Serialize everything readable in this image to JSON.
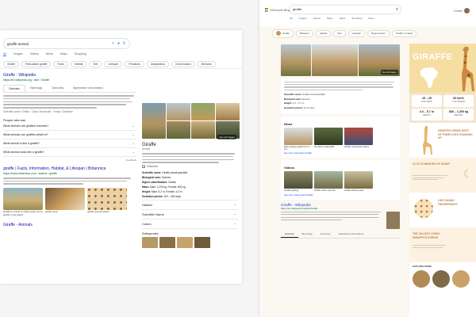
{
  "colors": {
    "google_link": "#1a0dab",
    "google_blue": "#1a73e8",
    "bing_blue": "#174ae4",
    "bing_accent": "#b7804a"
  },
  "google": {
    "query": "giraffe animal",
    "tabs": [
      "All",
      "Images",
      "Videos",
      "News",
      "Maps",
      "Shopping"
    ],
    "chips": [
      "Giraffe",
      "Reticulated giraffe",
      "Facts",
      "Habitat",
      "Diet",
      "Lifespan",
      "Predators",
      "Adaptations",
      "Conservation",
      "Behavior"
    ],
    "result1": {
      "title": "Giraffe - Wikipedia",
      "url": "https://en.wikipedia.org › wiki › Giraffe",
      "tabs": [
        "Overview",
        "Etymology",
        "Taxonomy",
        "Appearance and anatomy"
      ],
      "meta": "Scientific name: Giraffa · Class: Mammalia · Family: Giraffidae"
    },
    "paa": {
      "title": "People also ask",
      "items": [
        "What animals are giraffes enemies?",
        "What animals are giraffes afraid of?",
        "What animal is like a giraffe?",
        "What animal looks like a giraffe?"
      ],
      "feedback": "Feedback"
    },
    "result2": {
      "title": "giraffe | Facts, Information, Habitat, & Lifespan | Britannica",
      "url": "https://www.britannica.com › animal › giraffe",
      "thumbs": [
        "Giraffe in a field of yellow grass and a giraffe in the plains",
        "giraffe neck",
        "giraffe animal pattern"
      ]
    },
    "result3": {
      "title": "Giraffe - Animals"
    },
    "kp": {
      "more_images": "See all images",
      "title": "Giraffe",
      "subtitle": "Animal",
      "source": "Wikipedia",
      "facts": [
        {
          "k": "Scientific name:",
          "v": "Giraffa camelopardalis"
        },
        {
          "k": "Biological rank:",
          "v": "Species"
        },
        {
          "k": "Higher classification:",
          "v": "Giraffa"
        },
        {
          "k": "Mass:",
          "v": "Male: 1,200 kg, Female: 830 kg"
        },
        {
          "k": "Height:",
          "v": "Male: 5.2 m, Female: 4.3 m"
        },
        {
          "k": "Gestation period:",
          "v": "400 – 460 days"
        }
      ],
      "sections": [
        "Habitat",
        "Scientific Name",
        "Colors",
        "Subspecies"
      ]
    }
  },
  "bing": {
    "logo": "Microsoft Bing",
    "query": "giraffe",
    "tabs": [
      "All",
      "Images",
      "Videos",
      "Maps",
      "News",
      "Shopping",
      "More"
    ],
    "user": "Charles",
    "chips": [
      "Giraffe",
      "Behavior",
      "Habitat",
      "Diet",
      "Lifespan",
      "Reproduction",
      "Giraffe vs Okapi"
    ],
    "more_images": "See all images",
    "facts": [
      {
        "k": "Scientific name:",
        "v": "Giraffa camelopardalis"
      },
      {
        "k": "Biological rank:",
        "v": "Species"
      },
      {
        "k": "Height:",
        "v": "4.3 – 5.7 m"
      },
      {
        "k": "Gestation period:",
        "v": "15 months"
      }
    ],
    "news": {
      "title": "News",
      "items": [
        "Rare spotless giraffe born in zoo",
        "The fall of a tall giraffe",
        "Giraffe conservation efforts"
      ],
      "more": "See more news about Giraffe"
    },
    "videos": {
      "title": "Videos",
      "items": [
        "Giraffes fighting",
        "Giraffe mother and calf",
        "Giraffe drinking water"
      ],
      "more": "See more videos about Giraffe"
    },
    "result": {
      "title": "Giraffe - Wikipedia",
      "url": "https://en.wikipedia.org/wiki/Giraffe",
      "tabs": [
        "Overview",
        "Etymology",
        "Taxonomy",
        "Appearance and anatomy"
      ]
    },
    "side": {
      "title": "GIRAFFE",
      "stats": [
        {
          "label": "LIFE SPAN",
          "value": "15 – 25"
        },
        {
          "label": "TOP SPEED",
          "value": "60 km/h"
        },
        {
          "label": "HEIGHT",
          "value": "4.3 – 5.7 m"
        },
        {
          "label": "WEIGHT",
          "value": "830 – 1,200 kg"
        }
      ],
      "band1": "GIRAFFES SPEND MOST OF THEIR LIVES STANDING UP",
      "band2": "10 TO 30 MINUTES OF SLEEP",
      "band3": "LIKE HUMAN FINGERPRINTS",
      "band4": "THE TALLEST LIVING GIRAFFE IS FOREST",
      "explore": "EXPLORE MORE"
    }
  }
}
